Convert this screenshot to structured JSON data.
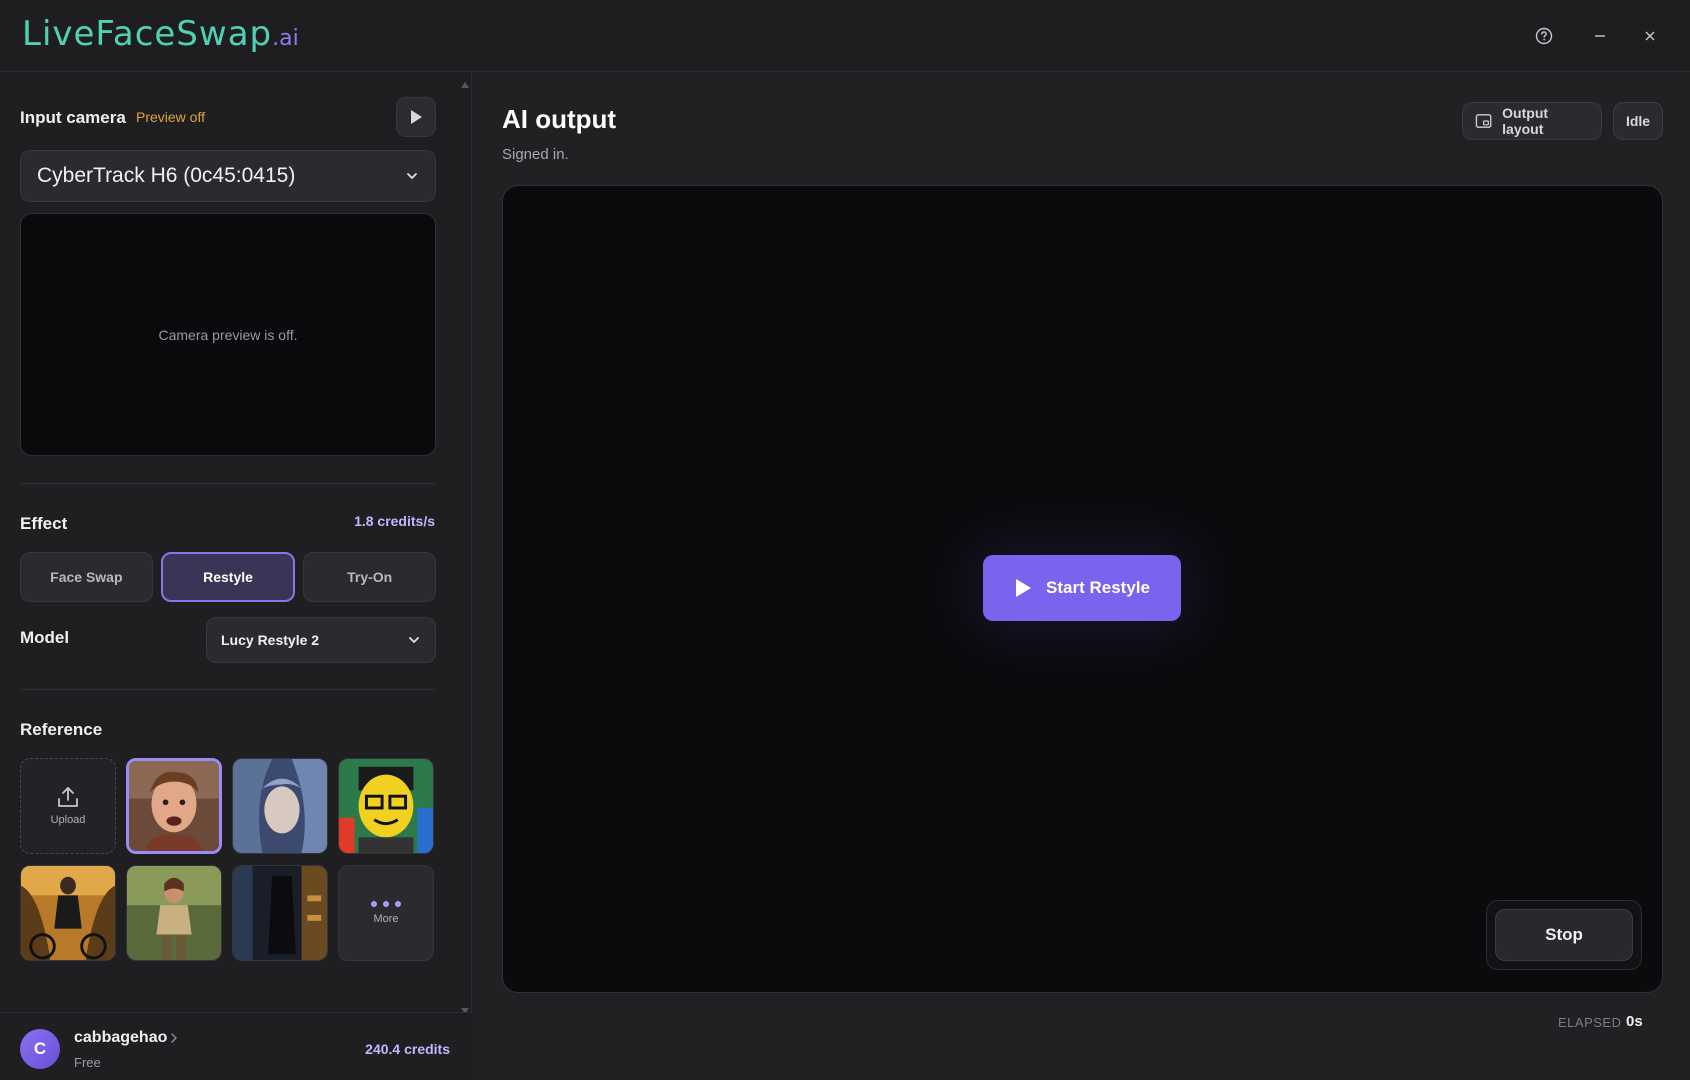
{
  "app": {
    "logo_main": "LiveFaceSwap",
    "logo_suffix": ".ai"
  },
  "window_controls": [
    "help-icon",
    "minimize-icon",
    "close-icon"
  ],
  "sidebar": {
    "input_camera": {
      "title": "Input camera",
      "preview_status": "Preview off",
      "selected_camera": "CyberTrack H6 (0c45:0415)",
      "preview_message": "Camera preview is off."
    },
    "effect": {
      "title": "Effect",
      "credits_rate": "1.8 credits/s",
      "tabs": [
        {
          "label": "Face Swap",
          "active": false
        },
        {
          "label": "Restyle",
          "active": true
        },
        {
          "label": "Try-On",
          "active": false
        }
      ]
    },
    "model": {
      "title": "Model",
      "selected": "Lucy Restyle 2"
    },
    "reference": {
      "title": "Reference",
      "upload_label": "Upload",
      "more_label": "More",
      "selected_index": 0
    },
    "user": {
      "initial": "C",
      "name": "cabbagehao",
      "plan": "Free",
      "credits": "240.4 credits"
    }
  },
  "main": {
    "title": "AI output",
    "status_message": "Signed in.",
    "output_layout_label": "Output layout",
    "state_badge": "Idle",
    "start_label": "Start Restyle",
    "stop_label": "Stop",
    "elapsed_label": "ELAPSED",
    "elapsed_value": "0s"
  },
  "colors": {
    "accent": "#7b63ee",
    "teal_logo": "#4fd1b3",
    "warning": "#e0a23c",
    "credits": "#c0b7ff"
  }
}
